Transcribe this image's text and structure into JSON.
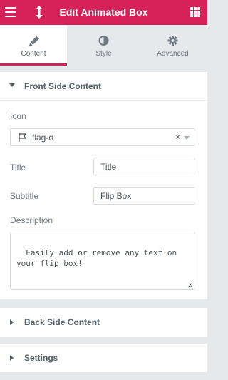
{
  "header": {
    "title": "Edit Animated Box",
    "menu_icon": "hamburger-icon",
    "resize_icon": "vertical-arrows-icon",
    "apps_icon": "grid-icon"
  },
  "tabs": [
    {
      "label": "Content",
      "icon": "pencil-icon",
      "active": true
    },
    {
      "label": "Style",
      "icon": "contrast-icon",
      "active": false
    },
    {
      "label": "Advanced",
      "icon": "gear-icon",
      "active": false
    }
  ],
  "front_side": {
    "title": "Front Side Content",
    "icon_label": "Icon",
    "icon_value": "flag-o",
    "icon_clear": "×",
    "title_label": "Title",
    "title_value": "Title",
    "subtitle_label": "Subtitle",
    "subtitle_value": "Flip Box",
    "description_label": "Description",
    "description_value": "Easily add or remove any text on your flip box!"
  },
  "back_side": {
    "title": "Back Side Content"
  },
  "settings": {
    "title": "Settings"
  },
  "colors": {
    "accent": "#d5235a",
    "panel_bg": "#e6e9ec"
  }
}
